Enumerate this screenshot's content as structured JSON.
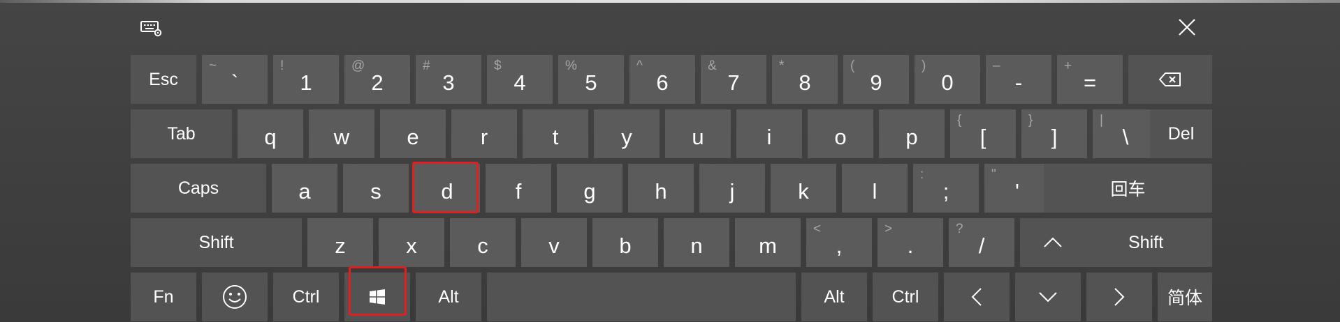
{
  "window": {
    "settings_icon": "keyboard-settings-icon",
    "close_icon": "close-icon"
  },
  "rows": [
    {
      "keys": [
        {
          "id": "esc",
          "label": "Esc",
          "type": "fn"
        },
        {
          "id": "backtick",
          "label": "`",
          "shift": "~",
          "type": "char"
        },
        {
          "id": "1",
          "label": "1",
          "shift": "!",
          "type": "char"
        },
        {
          "id": "2",
          "label": "2",
          "shift": "@",
          "type": "char"
        },
        {
          "id": "3",
          "label": "3",
          "shift": "#",
          "type": "char"
        },
        {
          "id": "4",
          "label": "4",
          "shift": "$",
          "type": "char"
        },
        {
          "id": "5",
          "label": "5",
          "shift": "%",
          "type": "char"
        },
        {
          "id": "6",
          "label": "6",
          "shift": "^",
          "type": "char"
        },
        {
          "id": "7",
          "label": "7",
          "shift": "&",
          "type": "char"
        },
        {
          "id": "8",
          "label": "8",
          "shift": "*",
          "type": "char"
        },
        {
          "id": "9",
          "label": "9",
          "shift": "(",
          "type": "char"
        },
        {
          "id": "0",
          "label": "0",
          "shift": ")",
          "type": "char"
        },
        {
          "id": "minus",
          "label": "-",
          "shift": "–",
          "type": "char"
        },
        {
          "id": "equals",
          "label": "=",
          "shift": "+",
          "type": "char"
        },
        {
          "id": "backspace",
          "icon": "backspace-icon",
          "type": "fn"
        }
      ]
    },
    {
      "keys": [
        {
          "id": "tab",
          "label": "Tab",
          "type": "fn"
        },
        {
          "id": "q",
          "label": "q",
          "type": "char"
        },
        {
          "id": "w",
          "label": "w",
          "type": "char"
        },
        {
          "id": "e",
          "label": "e",
          "type": "char"
        },
        {
          "id": "r",
          "label": "r",
          "type": "char"
        },
        {
          "id": "t",
          "label": "t",
          "type": "char"
        },
        {
          "id": "y",
          "label": "y",
          "type": "char"
        },
        {
          "id": "u",
          "label": "u",
          "type": "char"
        },
        {
          "id": "i",
          "label": "i",
          "type": "char"
        },
        {
          "id": "o",
          "label": "o",
          "type": "char"
        },
        {
          "id": "p",
          "label": "p",
          "type": "char"
        },
        {
          "id": "lbracket",
          "label": "[",
          "shift": "{",
          "type": "char"
        },
        {
          "id": "rbracket",
          "label": "]",
          "shift": "}",
          "type": "char"
        },
        {
          "id": "backslash",
          "label": "\\",
          "shift": "|",
          "type": "char"
        },
        {
          "id": "del",
          "label": "Del",
          "type": "fn"
        }
      ]
    },
    {
      "keys": [
        {
          "id": "caps",
          "label": "Caps",
          "type": "fn"
        },
        {
          "id": "a",
          "label": "a",
          "type": "char"
        },
        {
          "id": "s",
          "label": "s",
          "type": "char"
        },
        {
          "id": "d",
          "label": "d",
          "type": "char",
          "highlighted": true
        },
        {
          "id": "f",
          "label": "f",
          "type": "char"
        },
        {
          "id": "g",
          "label": "g",
          "type": "char"
        },
        {
          "id": "h",
          "label": "h",
          "type": "char"
        },
        {
          "id": "j",
          "label": "j",
          "type": "char"
        },
        {
          "id": "k",
          "label": "k",
          "type": "char"
        },
        {
          "id": "l",
          "label": "l",
          "type": "char"
        },
        {
          "id": "semicolon",
          "label": ";",
          "shift": ":",
          "type": "char"
        },
        {
          "id": "quote",
          "label": "'",
          "shift": "\"",
          "type": "char"
        },
        {
          "id": "enter",
          "label": "回车",
          "type": "fn"
        }
      ]
    },
    {
      "keys": [
        {
          "id": "lshift",
          "label": "Shift",
          "type": "fn"
        },
        {
          "id": "z",
          "label": "z",
          "type": "char"
        },
        {
          "id": "x",
          "label": "x",
          "type": "char"
        },
        {
          "id": "c",
          "label": "c",
          "type": "char"
        },
        {
          "id": "v",
          "label": "v",
          "type": "char"
        },
        {
          "id": "b",
          "label": "b",
          "type": "char"
        },
        {
          "id": "n",
          "label": "n",
          "type": "char"
        },
        {
          "id": "m",
          "label": "m",
          "type": "char"
        },
        {
          "id": "comma",
          "label": ",",
          "shift": "<",
          "type": "char"
        },
        {
          "id": "period",
          "label": ".",
          "shift": ">",
          "type": "char"
        },
        {
          "id": "slash",
          "label": "/",
          "shift": "?",
          "type": "char"
        },
        {
          "id": "up",
          "icon": "chevron-up-icon",
          "type": "fn"
        },
        {
          "id": "rshift",
          "label": "Shift",
          "type": "fn"
        }
      ]
    },
    {
      "keys": [
        {
          "id": "fn",
          "label": "Fn",
          "type": "fn"
        },
        {
          "id": "emoji",
          "icon": "smiley-icon",
          "type": "fn"
        },
        {
          "id": "lctrl",
          "label": "Ctrl",
          "type": "fn"
        },
        {
          "id": "win",
          "icon": "windows-logo-icon",
          "type": "fn",
          "highlighted": true
        },
        {
          "id": "lalt",
          "label": "Alt",
          "type": "fn"
        },
        {
          "id": "space",
          "label": "",
          "type": "fn"
        },
        {
          "id": "ralt",
          "label": "Alt",
          "type": "fn"
        },
        {
          "id": "rctrl",
          "label": "Ctrl",
          "type": "fn"
        },
        {
          "id": "left",
          "icon": "chevron-left-icon",
          "type": "fn"
        },
        {
          "id": "down",
          "icon": "chevron-down-icon",
          "type": "fn"
        },
        {
          "id": "right",
          "icon": "chevron-right-icon",
          "type": "fn"
        },
        {
          "id": "lang",
          "label": "简体",
          "type": "fn"
        }
      ]
    }
  ],
  "colors": {
    "background": "#3e3e3e",
    "key": "#5b5b5b",
    "key_text": "#ffffff",
    "shift_text": "#a6a6a6",
    "highlight": "#e02020"
  }
}
